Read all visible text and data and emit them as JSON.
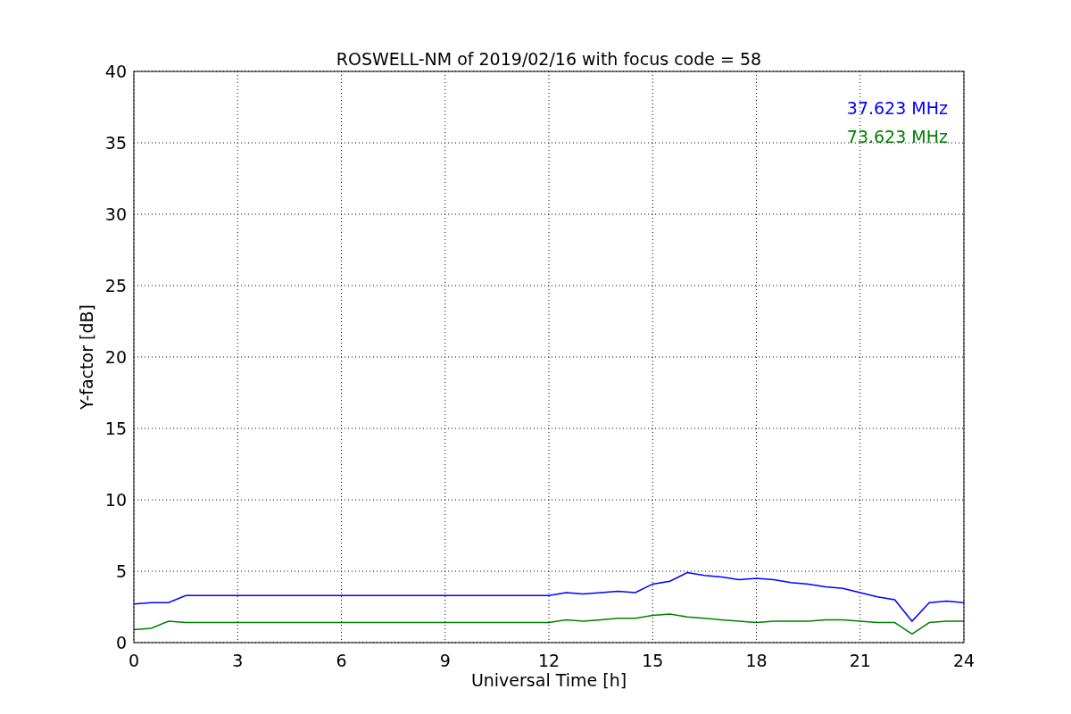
{
  "chart_data": {
    "type": "line",
    "title": "ROSWELL-NM of 2019/02/16 with focus code = 58",
    "xlabel": "Universal Time [h]",
    "ylabel": "Y-factor [dB]",
    "x": [
      0,
      0.5,
      1,
      1.5,
      2,
      2.5,
      3,
      3.5,
      4,
      4.5,
      5,
      5.5,
      6,
      6.5,
      7,
      7.5,
      8,
      8.5,
      9,
      9.5,
      10,
      10.5,
      11,
      11.5,
      12,
      12.5,
      13,
      13.5,
      14,
      14.5,
      15,
      15.5,
      16,
      16.5,
      17,
      17.5,
      18,
      18.5,
      19,
      19.5,
      20,
      20.5,
      21,
      21.5,
      22,
      22.5,
      23,
      23.5,
      24
    ],
    "series": [
      {
        "name": "37.623 MHz",
        "color": "#0000ff",
        "values": [
          2.7,
          2.8,
          2.8,
          3.3,
          3.3,
          3.3,
          3.3,
          3.3,
          3.3,
          3.3,
          3.3,
          3.3,
          3.3,
          3.3,
          3.3,
          3.3,
          3.3,
          3.3,
          3.3,
          3.3,
          3.3,
          3.3,
          3.3,
          3.3,
          3.3,
          3.5,
          3.4,
          3.5,
          3.6,
          3.5,
          4.1,
          4.3,
          4.9,
          4.7,
          4.6,
          4.4,
          4.5,
          4.4,
          4.2,
          4.1,
          3.9,
          3.8,
          3.5,
          3.2,
          3.0,
          1.5,
          2.8,
          2.9,
          2.8
        ]
      },
      {
        "name": "73.623 MHz",
        "color": "#008000",
        "values": [
          0.9,
          1.0,
          1.5,
          1.4,
          1.4,
          1.4,
          1.4,
          1.4,
          1.4,
          1.4,
          1.4,
          1.4,
          1.4,
          1.4,
          1.4,
          1.4,
          1.4,
          1.4,
          1.4,
          1.4,
          1.4,
          1.4,
          1.4,
          1.4,
          1.4,
          1.6,
          1.5,
          1.6,
          1.7,
          1.7,
          1.9,
          2.0,
          1.8,
          1.7,
          1.6,
          1.5,
          1.4,
          1.5,
          1.5,
          1.5,
          1.6,
          1.6,
          1.5,
          1.4,
          1.4,
          0.6,
          1.4,
          1.5,
          1.5
        ]
      }
    ],
    "xlim": [
      0,
      24
    ],
    "ylim": [
      0,
      40
    ],
    "xticks": [
      0,
      3,
      6,
      9,
      12,
      15,
      18,
      21,
      24
    ],
    "yticks": [
      0,
      5,
      10,
      15,
      20,
      25,
      30,
      35,
      40
    ],
    "grid": true
  }
}
